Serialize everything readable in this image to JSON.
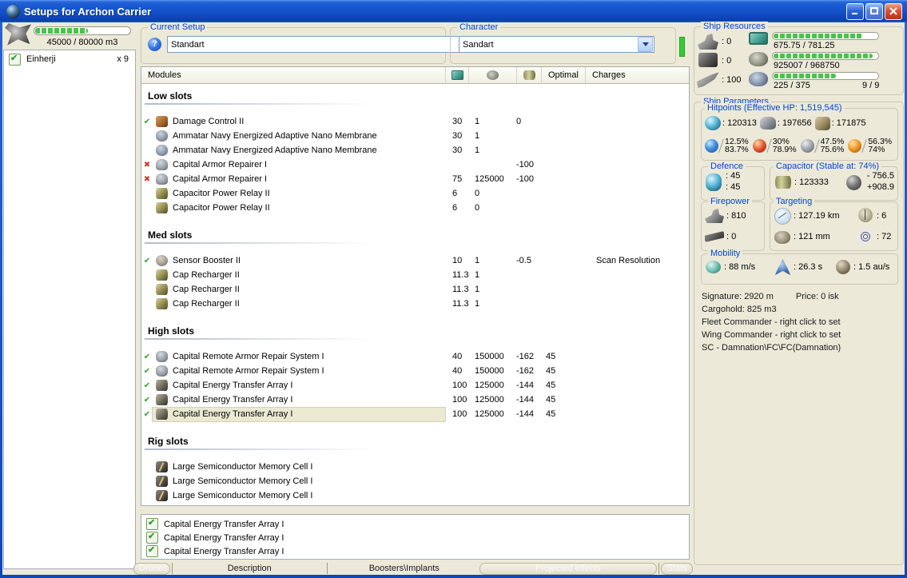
{
  "window": {
    "title": "Setups for Archon Carrier"
  },
  "sidebar": {
    "dronebay": {
      "capacity_label": "45000 / 80000 m3",
      "fill_pct": 56
    },
    "drones": [
      {
        "name": "Einherji",
        "qty": "x 9",
        "checked": true
      }
    ]
  },
  "setup_group": {
    "label": "Current Setup",
    "combo_value": "Standart",
    "help_glyph": "?"
  },
  "character_group": {
    "label": "Character",
    "combo_value": "Sandart"
  },
  "modules_panel": {
    "title": "Modules",
    "columns": {
      "optimal": "Optimal",
      "charges": "Charges"
    },
    "sections": [
      {
        "title": "Low slots",
        "rows": [
          {
            "status": "ok",
            "icon": "damage-control",
            "name": "Damage Control II",
            "cpu": "30",
            "pg": "1",
            "cap": "0",
            "opt": "",
            "charges": ""
          },
          {
            "status": "",
            "icon": "nano-membrane",
            "name": "Ammatar Navy Energized Adaptive Nano Membrane",
            "cpu": "30",
            "pg": "1",
            "cap": "",
            "opt": "",
            "charges": ""
          },
          {
            "status": "",
            "icon": "nano-membrane",
            "name": "Ammatar Navy Energized Adaptive Nano Membrane",
            "cpu": "30",
            "pg": "1",
            "cap": "",
            "opt": "",
            "charges": ""
          },
          {
            "status": "bad",
            "icon": "armor-repairer",
            "name": "Capital Armor Repairer I",
            "cpu": "",
            "pg": "",
            "cap": "-100",
            "opt": "",
            "charges": ""
          },
          {
            "status": "bad",
            "icon": "armor-repairer",
            "name": "Capital Armor Repairer I",
            "cpu": "75",
            "pg": "125000",
            "cap": "-100",
            "opt": "",
            "charges": ""
          },
          {
            "status": "",
            "icon": "cap-relay",
            "name": "Capacitor Power Relay II",
            "cpu": "6",
            "pg": "0",
            "cap": "",
            "opt": "",
            "charges": ""
          },
          {
            "status": "",
            "icon": "cap-relay",
            "name": "Capacitor Power Relay II",
            "cpu": "6",
            "pg": "0",
            "cap": "",
            "opt": "",
            "charges": ""
          }
        ]
      },
      {
        "title": "Med slots",
        "rows": [
          {
            "status": "ok",
            "icon": "sensor-booster",
            "name": "Sensor Booster II",
            "cpu": "10",
            "pg": "1",
            "cap": "-0.5",
            "opt": "",
            "charges": "Scan Resolution"
          },
          {
            "status": "",
            "icon": "cap-recharger",
            "name": "Cap Recharger II",
            "cpu": "11.3",
            "pg": "1",
            "cap": "",
            "opt": "",
            "charges": ""
          },
          {
            "status": "",
            "icon": "cap-recharger",
            "name": "Cap Recharger II",
            "cpu": "11.3",
            "pg": "1",
            "cap": "",
            "opt": "",
            "charges": ""
          },
          {
            "status": "",
            "icon": "cap-recharger",
            "name": "Cap Recharger II",
            "cpu": "11.3",
            "pg": "1",
            "cap": "",
            "opt": "",
            "charges": ""
          }
        ]
      },
      {
        "title": "High slots",
        "rows": [
          {
            "status": "ok",
            "icon": "remote-repair",
            "name": "Capital Remote Armor Repair System I",
            "cpu": "40",
            "pg": "150000",
            "cap": "-162",
            "opt": "45",
            "charges": ""
          },
          {
            "status": "ok",
            "icon": "remote-repair",
            "name": "Capital Remote Armor Repair System I",
            "cpu": "40",
            "pg": "150000",
            "cap": "-162",
            "opt": "45",
            "charges": ""
          },
          {
            "status": "ok",
            "icon": "energy-transfer",
            "name": "Capital Energy Transfer Array I",
            "cpu": "100",
            "pg": "125000",
            "cap": "-144",
            "opt": "45",
            "charges": ""
          },
          {
            "status": "ok",
            "icon": "energy-transfer",
            "name": "Capital Energy Transfer Array I",
            "cpu": "100",
            "pg": "125000",
            "cap": "-144",
            "opt": "45",
            "charges": ""
          },
          {
            "status": "ok",
            "icon": "energy-transfer",
            "name": "Capital Energy Transfer Array I",
            "cpu": "100",
            "pg": "125000",
            "cap": "-144",
            "opt": "45",
            "charges": "",
            "selected": true
          }
        ]
      },
      {
        "title": "Rig slots",
        "rows": [
          {
            "status": "",
            "icon": "memory-cell",
            "name": "Large Semiconductor Memory Cell I",
            "cpu": "",
            "pg": "",
            "cap": "",
            "opt": "",
            "charges": ""
          },
          {
            "status": "",
            "icon": "memory-cell",
            "name": "Large Semiconductor Memory Cell I",
            "cpu": "",
            "pg": "",
            "cap": "",
            "opt": "",
            "charges": ""
          },
          {
            "status": "",
            "icon": "memory-cell",
            "name": "Large Semiconductor Memory Cell I",
            "cpu": "",
            "pg": "",
            "cap": "",
            "opt": "",
            "charges": ""
          }
        ]
      }
    ]
  },
  "charges_panel": {
    "items": [
      {
        "label": "Capital Energy Transfer Array I",
        "checked": true
      },
      {
        "label": "Capital Energy Transfer Array I",
        "checked": true
      },
      {
        "label": "Capital Energy Transfer Array I",
        "checked": true
      }
    ]
  },
  "bottom_bar": {
    "drones": "Drones",
    "description": "Description",
    "boosters": "Boosters\\Implants",
    "projected": "Projected effects",
    "stats": "Stats"
  },
  "ship_resources": {
    "label": "Ship Resources",
    "turret_value": ": 0",
    "launcher_value": ": 0",
    "calibration_value": ": 100",
    "cpu": {
      "text": "675.75 / 781.25",
      "pct": 86
    },
    "powergrid": {
      "text": "925007 / 968750",
      "pct": 95
    },
    "drones": {
      "text": "225 / 375",
      "slots": "9 / 9",
      "pct": 60
    }
  },
  "ship_parameters": {
    "label": "Ship Parameters",
    "hitpoints": {
      "label": "Hitpoints (Effective HP: 1,519,545)",
      "shield": ": 120313",
      "armor": ": 197656",
      "structure": ": 171875",
      "resists": [
        {
          "name": "em",
          "top": "12.5%",
          "bottom": "83.7%"
        },
        {
          "name": "thermal",
          "top": "30%",
          "bottom": "78.9%"
        },
        {
          "name": "kinetic",
          "top": "47.5%",
          "bottom": "75.6%"
        },
        {
          "name": "explosive",
          "top": "56.3%",
          "bottom": "74%"
        }
      ]
    },
    "defence": {
      "label": "Defence",
      "line1": ": 45",
      "line2": ": 45"
    },
    "capacitor": {
      "label": "Capacitor (Stable at: 74%)",
      "amount": ": 123333",
      "peak_neg": "- 756.5",
      "peak_pos": "+908.9"
    },
    "firepower": {
      "label": "Firepower",
      "turret": ": 810",
      "missile": ": 0"
    },
    "targeting": {
      "label": "Targeting",
      "range": ": 127.19 km",
      "max_targets": ": 6",
      "sig_radius": ": 121 mm",
      "scan_res": ": 72"
    },
    "mobility": {
      "label": "Mobility",
      "speed": ": 88 m/s",
      "align_time": ": 26.3 s",
      "warp_speed": ": 1.5 au/s"
    },
    "info": {
      "signature": "Signature: 2920 m",
      "price": "Price: 0 isk",
      "cargohold": "Cargohold: 825 m3",
      "fleet": "Fleet Commander - right click to set",
      "wing": "Wing Commander - right click to set",
      "sc": "SC - Damnation\\FC\\FC(Damnation)"
    }
  }
}
